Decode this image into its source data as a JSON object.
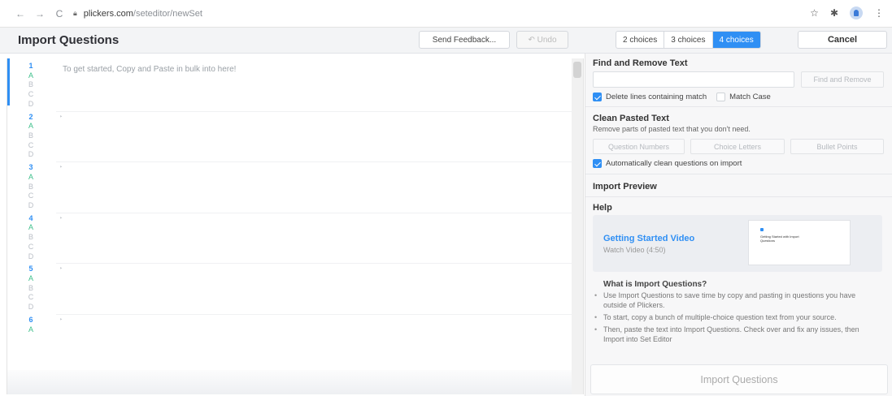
{
  "browser": {
    "back_icon": "←",
    "forward_icon": "→",
    "reload_icon": "C",
    "url_domain": "plickers.com",
    "url_path": "/seteditor/newSet",
    "star_icon": "☆",
    "extension_icon": "✱",
    "menu_icon": "⋮"
  },
  "header": {
    "title": "Import Questions",
    "feedback_label": "Send Feedback...",
    "undo_label": "↶ Undo",
    "choices": [
      "2 choices",
      "3 choices",
      "4 choices"
    ],
    "active_choice": "4 choices",
    "cancel_label": "Cancel"
  },
  "editor": {
    "placeholder": "To get started, Copy and Paste in bulk into here!",
    "blocks": [
      {
        "number": "1",
        "letters": [
          "A",
          "B",
          "C",
          "D"
        ]
      },
      {
        "number": "2",
        "letters": [
          "A",
          "B",
          "C",
          "D"
        ]
      },
      {
        "number": "3",
        "letters": [
          "A",
          "B",
          "C",
          "D"
        ]
      },
      {
        "number": "4",
        "letters": [
          "A",
          "B",
          "C",
          "D"
        ]
      },
      {
        "number": "5",
        "letters": [
          "A",
          "B",
          "C",
          "D"
        ]
      },
      {
        "number": "6",
        "letters": [
          "A"
        ]
      }
    ]
  },
  "panel": {
    "find_title": "Find and Remove Text",
    "find_button": "Find and Remove",
    "delete_lines_label": "Delete lines containing match",
    "match_case_label": "Match Case",
    "clean_title": "Clean Pasted Text",
    "clean_desc": "Remove parts of pasted text that you don't need.",
    "clean_buttons": [
      "Question Numbers",
      "Choice Letters",
      "Bullet Points"
    ],
    "auto_clean_label": "Automatically clean questions on import",
    "preview_title": "Import Preview",
    "help_title": "Help",
    "video_title": "Getting Started Video",
    "video_sub": "Watch Video (4:50)",
    "thumbnail_text": "Getting Started with Import Questions",
    "what_title": "What is Import Questions?",
    "bullets": [
      "Use Import Questions to save time by copy and pasting in questions you have outside of Plickers.",
      "To start, copy a bunch of multiple-choice question text from your source.",
      "Then, paste the text into Import Questions. Check over and fix any issues, then Import into Set Editor"
    ],
    "import_button": "Import Questions"
  }
}
